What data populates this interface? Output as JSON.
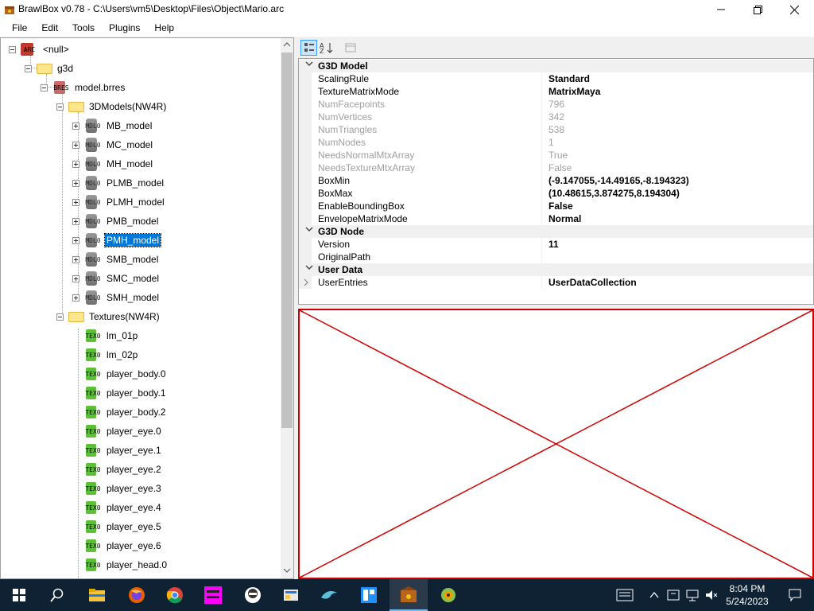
{
  "window": {
    "title": "BrawlBox v0.78 - C:\\Users\\vm5\\Desktop\\Files\\Object\\Mario.arc"
  },
  "menu": [
    "File",
    "Edit",
    "Tools",
    "Plugins",
    "Help"
  ],
  "tree": {
    "root": {
      "icon_text": "ARC",
      "label": "<null>"
    },
    "g3d": {
      "label": "g3d"
    },
    "brres": {
      "icon_text": "BRES",
      "label": "model.brres"
    },
    "models_folder": {
      "label": "3DModels(NW4R)"
    },
    "models": [
      {
        "icon_text": "MDL0",
        "label": "MB_model"
      },
      {
        "icon_text": "MDL0",
        "label": "MC_model"
      },
      {
        "icon_text": "MDL0",
        "label": "MH_model"
      },
      {
        "icon_text": "MDL0",
        "label": "PLMB_model"
      },
      {
        "icon_text": "MDL0",
        "label": "PLMH_model"
      },
      {
        "icon_text": "MDL0",
        "label": "PMB_model"
      },
      {
        "icon_text": "MDL0",
        "label": "PMH_model",
        "selected": true
      },
      {
        "icon_text": "MDL0",
        "label": "SMB_model"
      },
      {
        "icon_text": "MDL0",
        "label": "SMC_model"
      },
      {
        "icon_text": "MDL0",
        "label": "SMH_model"
      }
    ],
    "textures_folder": {
      "label": "Textures(NW4R)"
    },
    "textures": [
      {
        "icon_text": "TEX0",
        "label": "lm_01p"
      },
      {
        "icon_text": "TEX0",
        "label": "lm_02p"
      },
      {
        "icon_text": "TEX0",
        "label": "player_body.0"
      },
      {
        "icon_text": "TEX0",
        "label": "player_body.1"
      },
      {
        "icon_text": "TEX0",
        "label": "player_body.2"
      },
      {
        "icon_text": "TEX0",
        "label": "player_eye.0"
      },
      {
        "icon_text": "TEX0",
        "label": "player_eye.1"
      },
      {
        "icon_text": "TEX0",
        "label": "player_eye.2"
      },
      {
        "icon_text": "TEX0",
        "label": "player_eye.3"
      },
      {
        "icon_text": "TEX0",
        "label": "player_eye.4"
      },
      {
        "icon_text": "TEX0",
        "label": "player_eye.5"
      },
      {
        "icon_text": "TEX0",
        "label": "player_eye.6"
      },
      {
        "icon_text": "TEX0",
        "label": "player_head.0"
      }
    ]
  },
  "properties": {
    "categories": [
      {
        "name": "G3D Model",
        "rows": [
          {
            "name": "ScalingRule",
            "value": "Standard",
            "style": "bold"
          },
          {
            "name": "TextureMatrixMode",
            "value": "MatrixMaya",
            "style": "bold"
          },
          {
            "name": "NumFacepoints",
            "value": "796",
            "style": "disabled"
          },
          {
            "name": "NumVertices",
            "value": "342",
            "style": "disabled"
          },
          {
            "name": "NumTriangles",
            "value": "538",
            "style": "disabled"
          },
          {
            "name": "NumNodes",
            "value": "1",
            "style": "disabled"
          },
          {
            "name": "NeedsNormalMtxArray",
            "value": "True",
            "style": "disabled"
          },
          {
            "name": "NeedsTextureMtxArray",
            "value": "False",
            "style": "disabled"
          },
          {
            "name": "BoxMin",
            "value": "(-9.147055,-14.49165,-8.194323)",
            "style": "bold"
          },
          {
            "name": "BoxMax",
            "value": "(10.48615,3.874275,8.194304)",
            "style": "bold"
          },
          {
            "name": "EnableBoundingBox",
            "value": "False",
            "style": "bold"
          },
          {
            "name": "EnvelopeMatrixMode",
            "value": "Normal",
            "style": "bold"
          }
        ]
      },
      {
        "name": "G3D Node",
        "rows": [
          {
            "name": "Version",
            "value": "11",
            "style": "bold"
          },
          {
            "name": "OriginalPath",
            "value": "",
            "style": "normal"
          }
        ]
      },
      {
        "name": "User Data",
        "rows": [
          {
            "name": "UserEntries",
            "value": "UserDataCollection",
            "style": "bold",
            "expandable": true
          }
        ]
      }
    ]
  },
  "taskbar": {
    "time": "8:04 PM",
    "date": "5/24/2023"
  },
  "colors": {
    "selection": "#0078d7",
    "preview_border": "#d00000",
    "taskbar_bg": "#0f2234"
  }
}
